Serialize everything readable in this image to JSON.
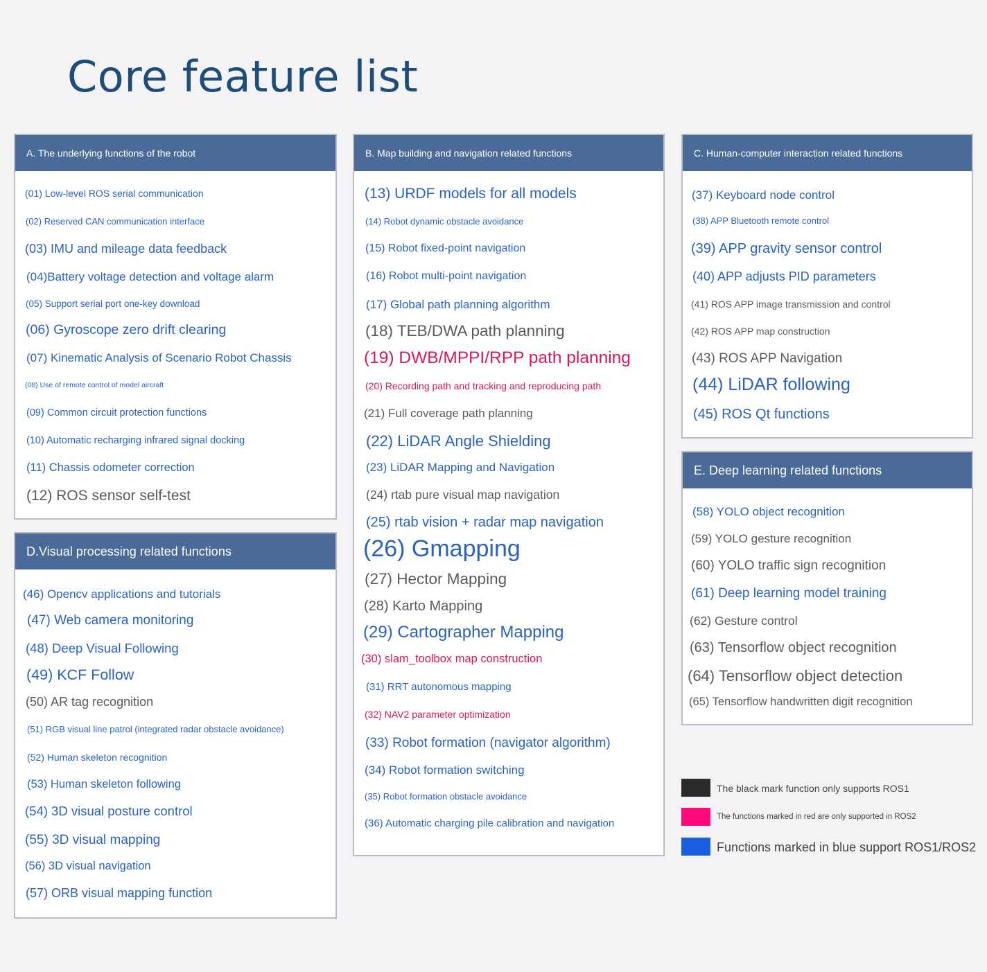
{
  "page": {
    "title": "Core feature list"
  },
  "colors": {
    "ros1": "#2b2b2b",
    "ros2": "#ff0a78",
    "both": "#1a5fe0"
  },
  "panels": {
    "a": {
      "header": "A. The underlying functions of the robot",
      "items": [
        {
          "text": "(01) Low-level ROS serial communication",
          "color": "blue"
        },
        {
          "text": "(02) Reserved CAN communication interface",
          "color": "blue"
        },
        {
          "text": "(03) IMU and mileage data feedback",
          "color": "blue"
        },
        {
          "text": "(04)Battery voltage detection and voltage alarm",
          "color": "blue"
        },
        {
          "text": "(05) Support serial port one-key download",
          "color": "blue"
        },
        {
          "text": "(06) Gyroscope zero drift clearing",
          "color": "blue"
        },
        {
          "text": "(07) Kinematic Analysis of Scenario Robot Chassis",
          "color": "blue"
        },
        {
          "text": "(08) Use of remote control of model aircraft",
          "color": "blue"
        },
        {
          "text": "(09) Common circuit protection functions",
          "color": "blue"
        },
        {
          "text": "(10) Automatic recharging infrared signal docking",
          "color": "blue"
        },
        {
          "text": "(11) Chassis odometer correction",
          "color": "blue"
        },
        {
          "text": "(12) ROS sensor self-test",
          "color": "gray"
        }
      ]
    },
    "b": {
      "header": "B. Map building and navigation related functions",
      "items": [
        {
          "text": "(13) URDF models for all models",
          "color": "blue"
        },
        {
          "text": "(14) Robot dynamic obstacle avoidance",
          "color": "blue"
        },
        {
          "text": "(15) Robot fixed-point navigation",
          "color": "blue"
        },
        {
          "text": "(16) Robot multi-point navigation",
          "color": "blue"
        },
        {
          "text": "(17) Global path planning algorithm",
          "color": "blue"
        },
        {
          "text": "(18) TEB/DWA path planning",
          "color": "gray"
        },
        {
          "text": "(19) DWB/MPPI/RPP path planning",
          "color": "red"
        },
        {
          "text": "(20) Recording path and tracking and reproducing path",
          "color": "red"
        },
        {
          "text": "(21) Full coverage path planning",
          "color": "gray"
        },
        {
          "text": "(22) LiDAR Angle Shielding",
          "color": "blue"
        },
        {
          "text": "(23) LiDAR Mapping and Navigation",
          "color": "blue"
        },
        {
          "text": "(24) rtab pure visual map navigation",
          "color": "gray"
        },
        {
          "text": "(25) rtab vision + radar map navigation",
          "color": "blue"
        },
        {
          "text": "(26) Gmapping",
          "color": "blue"
        },
        {
          "text": "(27) Hector Mapping",
          "color": "gray"
        },
        {
          "text": "(28) Karto Mapping",
          "color": "gray"
        },
        {
          "text": "(29) Cartographer Mapping",
          "color": "blue"
        },
        {
          "text": "(30) slam_toolbox map construction",
          "color": "red"
        },
        {
          "text": "(31) RRT autonomous mapping",
          "color": "blue"
        },
        {
          "text": "(32) NAV2 parameter optimization",
          "color": "red"
        },
        {
          "text": "(33) Robot formation (navigator algorithm)",
          "color": "blue"
        },
        {
          "text": "(34) Robot formation switching",
          "color": "blue"
        },
        {
          "text": "(35) Robot formation obstacle avoidance",
          "color": "blue"
        },
        {
          "text": "(36) Automatic charging pile calibration and navigation",
          "color": "blue"
        }
      ]
    },
    "c": {
      "header": "C. Human-computer interaction related functions",
      "items": [
        {
          "text": "(37) Keyboard node control",
          "color": "blue"
        },
        {
          "text": "(38) APP Bluetooth remote control",
          "color": "blue"
        },
        {
          "text": "(39) APP gravity sensor control",
          "color": "blue"
        },
        {
          "text": "(40) APP adjusts PID parameters",
          "color": "blue"
        },
        {
          "text": "(41) ROS APP image transmission and control",
          "color": "gray"
        },
        {
          "text": "(42) ROS APP map construction",
          "color": "gray"
        },
        {
          "text": "(43) ROS APP Navigation",
          "color": "gray"
        },
        {
          "text": "(44) LiDAR following",
          "color": "blue"
        },
        {
          "text": "(45) ROS Qt functions",
          "color": "blue"
        }
      ]
    },
    "d": {
      "header": "D.Visual processing related functions",
      "items": [
        {
          "text": "(46) Opencv applications and tutorials",
          "color": "blue"
        },
        {
          "text": "(47) Web camera monitoring",
          "color": "blue"
        },
        {
          "text": "(48) Deep Visual Following",
          "color": "blue"
        },
        {
          "text": "(49) KCF Follow",
          "color": "blue"
        },
        {
          "text": "(50) AR tag recognition",
          "color": "gray"
        },
        {
          "text": "(51) RGB visual line patrol (integrated radar obstacle avoidance)",
          "color": "blue"
        },
        {
          "text": "(52) Human skeleton recognition",
          "color": "blue"
        },
        {
          "text": "(53) Human skeleton following",
          "color": "blue"
        },
        {
          "text": "(54) 3D visual posture control",
          "color": "blue"
        },
        {
          "text": "(55) 3D visual mapping",
          "color": "blue"
        },
        {
          "text": "(56) 3D visual navigation",
          "color": "blue"
        },
        {
          "text": "(57) ORB visual mapping function",
          "color": "blue"
        }
      ]
    },
    "e": {
      "header": "E. Deep learning related functions",
      "items": [
        {
          "text": "(58) YOLO object recognition",
          "color": "blue"
        },
        {
          "text": "(59) YOLO gesture recognition",
          "color": "gray"
        },
        {
          "text": "(60) YOLO traffic sign recognition",
          "color": "gray"
        },
        {
          "text": "(61) Deep learning model training",
          "color": "blue"
        },
        {
          "text": "(62) Gesture control",
          "color": "gray"
        },
        {
          "text": "(63) Tensorflow object recognition",
          "color": "gray"
        },
        {
          "text": "(64) Tensorflow object detection",
          "color": "gray"
        },
        {
          "text": "(65) Tensorflow handwritten digit recognition",
          "color": "gray"
        }
      ]
    }
  },
  "legend": [
    {
      "text": "The black mark function only supports ROS1",
      "swatch": "#2b2b2b"
    },
    {
      "text": "The functions marked in red are only supported in ROS2",
      "swatch": "#ff0a78"
    },
    {
      "text": "Functions marked in blue support ROS1/ROS2",
      "swatch": "#1a5fe0"
    }
  ]
}
